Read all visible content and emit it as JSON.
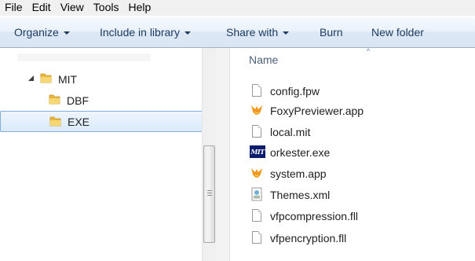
{
  "menubar": {
    "items": [
      "File",
      "Edit",
      "View",
      "Tools",
      "Help"
    ]
  },
  "toolbar": {
    "organize": "Organize",
    "include_in_library": "Include in library",
    "share_with": "Share with",
    "burn": "Burn",
    "new_folder": "New folder"
  },
  "tree": {
    "items": [
      {
        "label": "MIT",
        "expanded": true
      },
      {
        "label": "DBF"
      },
      {
        "label": "EXE",
        "selected": true
      }
    ]
  },
  "filelist": {
    "column_name": "Name",
    "files": [
      {
        "name": "config.fpw",
        "icon": "generic-file-icon"
      },
      {
        "name": "FoxyPreviewer.app",
        "icon": "fox-app-icon"
      },
      {
        "name": "local.mit",
        "icon": "generic-file-icon"
      },
      {
        "name": "orkester.exe",
        "icon": "mit-logo-icon"
      },
      {
        "name": "system.app",
        "icon": "fox-app-icon"
      },
      {
        "name": "Themes.xml",
        "icon": "xml-file-icon"
      },
      {
        "name": "vfpcompression.fll",
        "icon": "generic-file-icon"
      },
      {
        "name": "vfpencryption.fll",
        "icon": "generic-file-icon"
      }
    ]
  },
  "colors": {
    "toolbar_text": "#1c3a5e",
    "selection_border": "#84acdd",
    "folder_yellow": "#f2c94c"
  }
}
